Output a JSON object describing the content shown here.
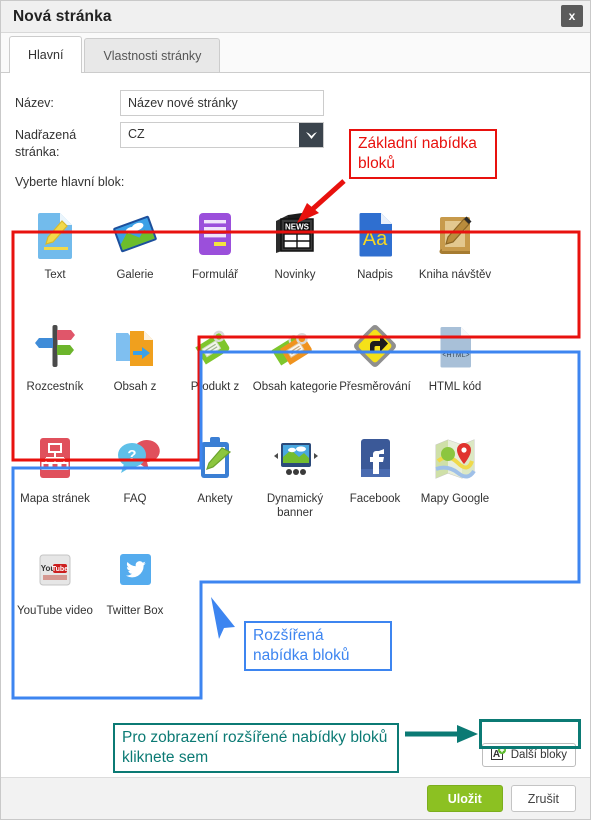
{
  "window": {
    "title": "Nová stránka",
    "close_label": "x"
  },
  "tabs": [
    {
      "label": "Hlavní",
      "active": true
    },
    {
      "label": "Vlastnosti stránky",
      "active": false
    }
  ],
  "form": {
    "name_label": "Název:",
    "name_value": "Název nové stránky",
    "parent_label": "Nadřazená stránka:",
    "parent_value": "CZ",
    "block_select_label": "Vyberte hlavní blok:"
  },
  "blocks": [
    [
      {
        "label": "Text",
        "icon": "text-document-pencil-icon"
      },
      {
        "label": "Galerie",
        "icon": "photo-gallery-icon"
      },
      {
        "label": "Formulář",
        "icon": "form-icon"
      },
      {
        "label": "Novinky",
        "icon": "news-icon"
      },
      {
        "label": "Nadpis",
        "icon": "heading-aa-icon"
      },
      {
        "label": "Kniha návštěv",
        "icon": "guestbook-icon"
      }
    ],
    [
      {
        "label": "Rozcestník",
        "icon": "signpost-icon"
      },
      {
        "label": "Obsah z",
        "icon": "content-from-icon"
      },
      {
        "label": "Produkt z",
        "icon": "product-tag-icon"
      },
      {
        "label": "Obsah kategorie",
        "icon": "category-tags-icon"
      },
      {
        "label": "Přesměrování",
        "icon": "redirect-arrow-icon"
      },
      {
        "label": "HTML kód",
        "icon": "html-code-icon"
      }
    ],
    [
      {
        "label": "Mapa stránek",
        "icon": "sitemap-icon"
      },
      {
        "label": "FAQ",
        "icon": "faq-speech-bubbles-icon"
      },
      {
        "label": "Ankety",
        "icon": "poll-clipboard-icon"
      },
      {
        "label": "Dynamický banner",
        "icon": "dynamic-banner-icon"
      },
      {
        "label": "Facebook",
        "icon": "facebook-icon"
      },
      {
        "label": "Mapy Google",
        "icon": "google-maps-icon"
      }
    ],
    [
      {
        "label": "YouTube video",
        "icon": "youtube-icon"
      },
      {
        "label": "Twitter Box",
        "icon": "twitter-bird-icon"
      }
    ]
  ],
  "more_button": {
    "label": "Další bloky",
    "icon": "add-block-icon"
  },
  "annotations": {
    "basic": {
      "text": "Základní nabídka bloků",
      "color": "#e8110e"
    },
    "extended": {
      "text": "Rozšířená nabídka bloků",
      "color": "#3d85f0"
    },
    "hint": {
      "text": "Pro zobrazení rozšířené nabídky bloků kliknete sem",
      "color": "#0b7a74"
    }
  },
  "footer": {
    "save_label": "Uložit",
    "cancel_label": "Zrušit",
    "save_color": "#8cc122"
  }
}
